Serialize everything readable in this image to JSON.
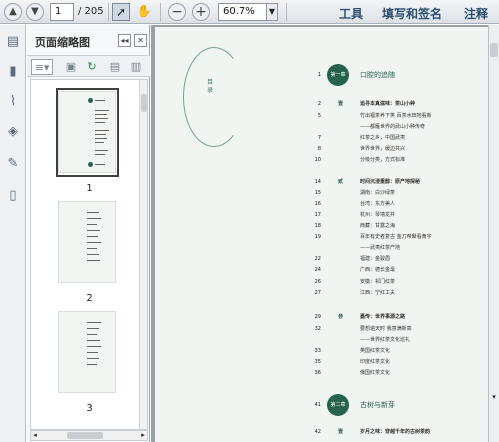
{
  "toolbar": {
    "page_current": "1",
    "page_total": "/ 205",
    "zoom": "60.7%",
    "links": [
      "工具",
      "填写和签名",
      "注释"
    ]
  },
  "panel": {
    "title": "页面缩略图"
  },
  "thumbnails": [
    {
      "label": "1"
    },
    {
      "label": "2"
    },
    {
      "label": "3"
    }
  ],
  "page": {
    "circle_text": "目录",
    "toc": [
      {
        "num": "1",
        "text": "口腔的追随",
        "type": "section",
        "badge": "第一章"
      },
      {
        "num": "2",
        "text": "追寻本真滋味：茶山小种",
        "type": "bold",
        "marker": "壹"
      },
      {
        "num": "5",
        "text": "竹出福茶养下笑  百茶水田地看新",
        "type": "entry"
      },
      {
        "num": "",
        "text": "——都雁世界的武山小种传奇",
        "type": "entry"
      },
      {
        "num": "7",
        "text": "红茶之乡，中国武夷",
        "type": "entry"
      },
      {
        "num": "8",
        "text": "世界世界，缓边共兴",
        "type": "entry"
      },
      {
        "num": "10",
        "text": "分级分类，方式标准",
        "type": "entry"
      },
      {
        "num": "14",
        "text": "时间沉浸重醇：原产地探秘",
        "type": "bold",
        "marker": "贰"
      },
      {
        "num": "15",
        "text": "湖南：白沙绿茶",
        "type": "entry"
      },
      {
        "num": "16",
        "text": "台湾：东方美人",
        "type": "entry"
      },
      {
        "num": "17",
        "text": "杭州：琴墙龙井",
        "type": "entry"
      },
      {
        "num": "18",
        "text": "西藏：甘露之海",
        "type": "entry"
      },
      {
        "num": "19",
        "text": "百年有史者复古  金刀帝聚看黄字",
        "type": "entry"
      },
      {
        "num": "",
        "text": "——武夷红茶产地",
        "type": "entry"
      },
      {
        "num": "22",
        "text": "福建：金骏眉",
        "type": "entry"
      },
      {
        "num": "24",
        "text": "广西：德长金毫",
        "type": "entry"
      },
      {
        "num": "26",
        "text": "安徽：祁门红茶",
        "type": "entry"
      },
      {
        "num": "27",
        "text": "江西：宁红工夫",
        "type": "entry"
      },
      {
        "num": "29",
        "text": "嘉传：世界事源之路",
        "type": "bold",
        "marker": "叁"
      },
      {
        "num": "32",
        "text": "要想遍天时  我意满新高",
        "type": "entry"
      },
      {
        "num": "",
        "text": "——世界红茶文化巡礼",
        "type": "entry"
      },
      {
        "num": "33",
        "text": "英国红茶文化",
        "type": "entry"
      },
      {
        "num": "35",
        "text": "印度红茶文化",
        "type": "entry"
      },
      {
        "num": "36",
        "text": "俄国红茶文化",
        "type": "entry"
      },
      {
        "num": "41",
        "text": "古树与新芽",
        "type": "section",
        "badge": "第二章"
      },
      {
        "num": "42",
        "text": "岁月之味：穿越千年的古树茶韵",
        "type": "bold",
        "marker": "壹"
      }
    ]
  }
}
